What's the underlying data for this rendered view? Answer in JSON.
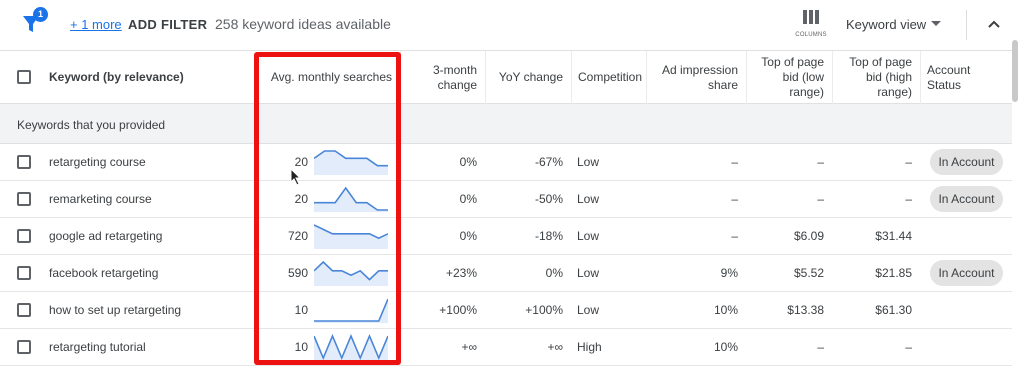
{
  "toolbar": {
    "filter_badge": "1",
    "more_link": "+ 1 more",
    "add_filter": "ADD FILTER",
    "ideas_count": "258 keyword ideas available",
    "columns_label": "COLUMNS",
    "keyword_view": "Keyword view"
  },
  "table": {
    "headers": {
      "keyword": "Keyword (by relevance)",
      "avg_monthly": "Avg. monthly searches",
      "three_month": "3-month change",
      "yoy": "YoY change",
      "competition": "Competition",
      "ad_impression": "Ad impression share",
      "top_low": "Top of page bid (low range)",
      "top_high": "Top of page bid (high range)",
      "account_status": "Account Status"
    },
    "section_label": "Keywords that you provided",
    "rows": [
      {
        "keyword": "retargeting course",
        "searches": "20",
        "three_month": "0%",
        "yoy": "-67%",
        "competition": "Low",
        "ad_impression": "–",
        "bid_low": "–",
        "bid_high": "–",
        "status": "In Account",
        "trend": [
          2,
          3,
          3,
          2,
          2,
          2,
          1,
          1
        ]
      },
      {
        "keyword": "remarketing course",
        "searches": "20",
        "three_month": "0%",
        "yoy": "-50%",
        "competition": "Low",
        "ad_impression": "–",
        "bid_low": "–",
        "bid_high": "–",
        "status": "In Account",
        "trend": [
          1,
          1,
          1,
          3,
          1,
          1,
          0,
          0
        ]
      },
      {
        "keyword": "google ad retargeting",
        "searches": "720",
        "three_month": "0%",
        "yoy": "-18%",
        "competition": "Low",
        "ad_impression": "–",
        "bid_low": "$6.09",
        "bid_high": "$31.44",
        "status": "",
        "trend": [
          5,
          4,
          3,
          3,
          3,
          3,
          3,
          2,
          3
        ]
      },
      {
        "keyword": "facebook retargeting",
        "searches": "590",
        "three_month": "+23%",
        "yoy": "0%",
        "competition": "Low",
        "ad_impression": "9%",
        "bid_low": "$5.52",
        "bid_high": "$21.85",
        "status": "In Account",
        "trend": [
          3,
          5,
          3,
          3,
          2,
          3,
          1,
          3,
          3
        ]
      },
      {
        "keyword": "how to set up retargeting",
        "searches": "10",
        "three_month": "+100%",
        "yoy": "+100%",
        "competition": "Low",
        "ad_impression": "10%",
        "bid_low": "$13.38",
        "bid_high": "$61.30",
        "status": "",
        "trend": [
          0,
          0,
          0,
          0,
          0,
          0,
          0,
          0,
          5
        ]
      },
      {
        "keyword": "retargeting tutorial",
        "searches": "10",
        "three_month": "+∞",
        "yoy": "+∞",
        "competition": "High",
        "ad_impression": "10%",
        "bid_low": "–",
        "bid_high": "–",
        "status": "",
        "trend": [
          5,
          0,
          5,
          0,
          5,
          0,
          5,
          0,
          5
        ]
      }
    ]
  },
  "colors": {
    "accent": "#1a73e8",
    "highlight": "#ee1111",
    "spark_line": "#4a86d8",
    "spark_fill": "#e3ecfa"
  },
  "icons": [
    "filter-icon",
    "columns-icon",
    "caret-down-icon",
    "chevron-up-icon",
    "cursor-arrow-icon"
  ]
}
